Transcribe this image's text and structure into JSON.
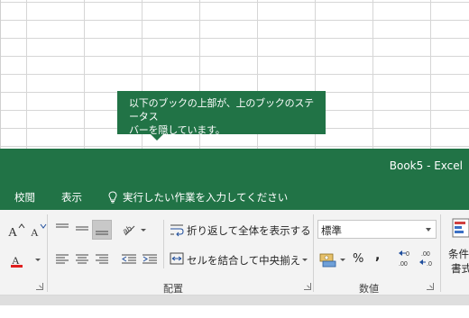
{
  "tooltip": {
    "line1": "以下のブックの上部が、上のブックのステータス",
    "line2": "バーを隠しています。"
  },
  "window": {
    "title": "Book5 - Excel"
  },
  "tabs": [
    {
      "label": "校閲"
    },
    {
      "label": "表示"
    }
  ],
  "tellme": {
    "text": "実行したい作業を入力してください"
  },
  "ribbon": {
    "wrap_text_label": "折り返して全体を表示する",
    "merge_center_label": "セルを結合して中央揃え",
    "number_format_value": "標準",
    "percent_symbol": "%",
    "comma_symbol": ",",
    "conditional_label_line1": "条件",
    "conditional_label_line2": "書式",
    "alignment_group_label": "配置",
    "number_group_label": "数値"
  },
  "colors": {
    "excel_green": "#217346",
    "ribbon_bg": "#f3f3f3"
  }
}
